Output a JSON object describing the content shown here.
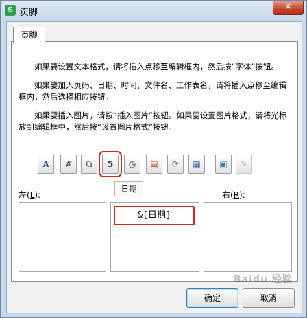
{
  "window": {
    "title": "页脚",
    "app_icon_glyph": "S",
    "close_glyph": "✕"
  },
  "tabs": [
    {
      "label": "页脚",
      "active": true
    }
  ],
  "instructions": [
    "如果要设置文本格式，请将插入点移至编辑框内，然后按“字体”按钮。",
    "如果要加入页码、日期、时间、文件名、工作表名，请将插入点移至编辑框内，然后选择相应按钮。",
    "如果要插入图片，请按“插入图片”按钮。如果要设置图片格式，请将光标放到编辑框中，然后按“设置图片格式”按钮。"
  ],
  "toolbar": {
    "buttons": [
      {
        "name": "font-button",
        "glyph": "A",
        "icon": "font-icon"
      },
      {
        "name": "page-number-button",
        "glyph": "#",
        "icon": "page-number-icon"
      },
      {
        "name": "page-count-button",
        "glyph": "⧉",
        "icon": "page-count-icon"
      },
      {
        "name": "date-button",
        "glyph": "5",
        "icon": "calendar-icon"
      },
      {
        "name": "time-button",
        "glyph": "◷",
        "icon": "clock-icon"
      },
      {
        "name": "file-path-button",
        "glyph": "▤",
        "icon": "file-path-icon"
      },
      {
        "name": "file-name-button",
        "glyph": "⟳",
        "icon": "file-name-icon"
      },
      {
        "name": "sheet-name-button",
        "glyph": "▦",
        "icon": "sheet-name-icon"
      },
      {
        "name": "insert-picture-button",
        "glyph": "▣",
        "icon": "picture-icon"
      },
      {
        "name": "format-picture-button",
        "glyph": "✎",
        "icon": "format-picture-icon"
      }
    ],
    "tooltip": "日期"
  },
  "sections": {
    "left": {
      "label": "左(",
      "key": "L",
      "suffix": "):",
      "content": ""
    },
    "center": {
      "content": "&[日期]"
    },
    "right": {
      "label": "右(",
      "key": "R",
      "suffix": "):",
      "content": ""
    }
  },
  "buttons": {
    "ok": "确定",
    "cancel": "取消"
  },
  "watermark": "Baidu 经验",
  "colors": {
    "highlight": "#d9241b",
    "app_icon": "#2aa34a"
  }
}
